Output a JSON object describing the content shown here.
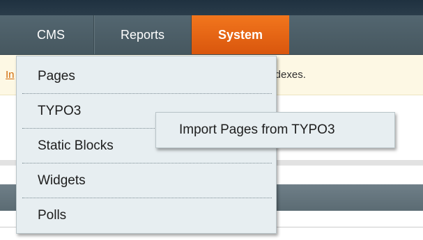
{
  "nav": {
    "items": [
      {
        "label": "CMS"
      },
      {
        "label": "Reports"
      },
      {
        "label": "System"
      }
    ]
  },
  "notice": {
    "left_link": "In",
    "text": "indexes."
  },
  "dropdown": {
    "items": [
      {
        "label": "Pages"
      },
      {
        "label": "TYPO3"
      },
      {
        "label": "Static Blocks"
      },
      {
        "label": "Widgets"
      },
      {
        "label": "Polls"
      }
    ],
    "submenu": {
      "items": [
        {
          "label": "Import Pages from TYPO3"
        }
      ]
    }
  },
  "colors": {
    "active_tab": "#e8651a",
    "nav_bg": "#4e6068",
    "notice_bg": "#fdf8e4",
    "menu_bg": "#e7eef1"
  }
}
